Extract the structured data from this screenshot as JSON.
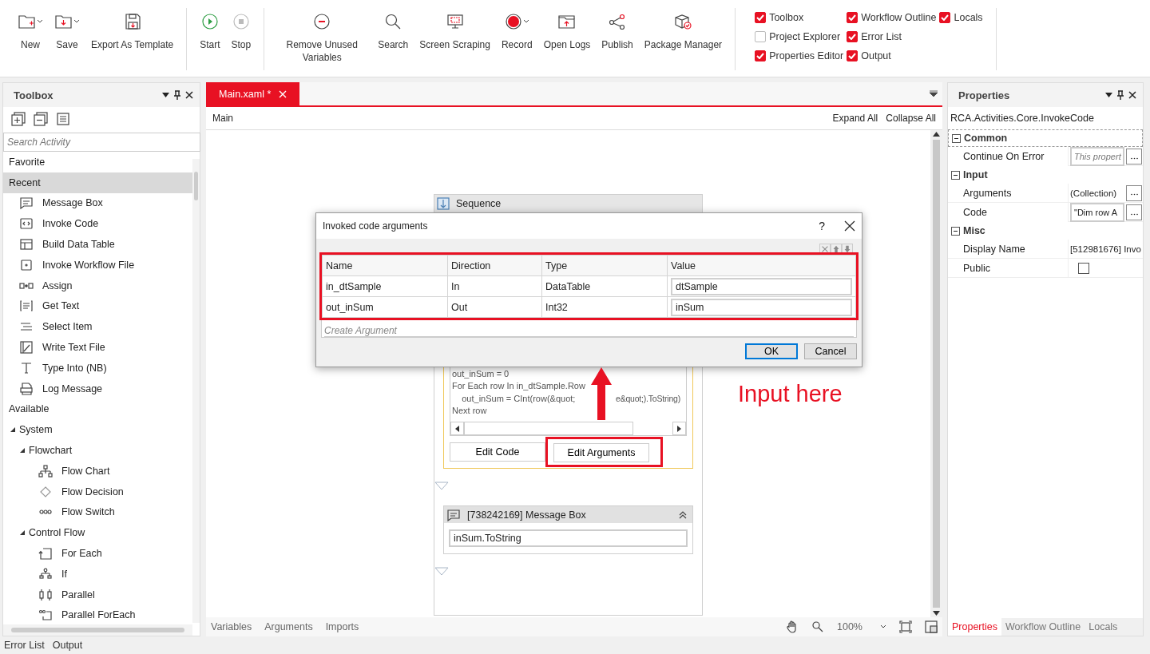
{
  "ribbon": {
    "groups": [
      {
        "buttons": [
          {
            "label": "New",
            "dropdown": true,
            "disabled": false
          },
          {
            "label": "Save",
            "dropdown": true,
            "disabled": false
          },
          {
            "label": "Export As Template",
            "dropdown": false,
            "disabled": false
          }
        ]
      },
      {
        "buttons": [
          {
            "label": "Start",
            "dropdown": false,
            "disabled": false
          },
          {
            "label": "Stop",
            "dropdown": false,
            "disabled": true
          }
        ]
      },
      {
        "buttons": [
          {
            "label": "Remove Unused Variables",
            "dropdown": false,
            "disabled": false
          },
          {
            "label": "Search",
            "dropdown": false,
            "disabled": false
          },
          {
            "label": "Screen Scraping",
            "dropdown": false,
            "disabled": false
          },
          {
            "label": "Record",
            "dropdown": true,
            "disabled": false
          },
          {
            "label": "Open Logs",
            "dropdown": false,
            "disabled": false
          },
          {
            "label": "Publish",
            "dropdown": false,
            "disabled": false
          },
          {
            "label": "Package Manager",
            "dropdown": false,
            "disabled": false
          }
        ]
      }
    ],
    "panes": [
      {
        "label": "Toolbox",
        "checked": true
      },
      {
        "label": "Project Explorer",
        "checked": false
      },
      {
        "label": "Properties Editor",
        "checked": true
      },
      {
        "label": "Workflow Outline",
        "checked": true
      },
      {
        "label": "Error List",
        "checked": true
      },
      {
        "label": "Output",
        "checked": true
      },
      {
        "label": "Locals",
        "checked": true
      }
    ]
  },
  "toolbox": {
    "title": "Toolbox",
    "search": {
      "placeholder": "Search Activity"
    },
    "tree": [
      {
        "label": "Favorite",
        "kind": "section",
        "selected": false
      },
      {
        "label": "Recent",
        "kind": "section",
        "selected": true,
        "children": [
          {
            "label": "Message Box",
            "kind": "item",
            "selected": false
          },
          {
            "label": "Invoke Code",
            "kind": "item",
            "selected": false
          },
          {
            "label": "Build Data Table",
            "kind": "item",
            "selected": false
          },
          {
            "label": "Invoke Workflow File",
            "kind": "item",
            "selected": false
          },
          {
            "label": "Assign",
            "kind": "item",
            "selected": false
          },
          {
            "label": "Get Text",
            "kind": "item",
            "selected": false
          },
          {
            "label": "Select Item",
            "kind": "item",
            "selected": false
          },
          {
            "label": "Write Text File",
            "kind": "item",
            "selected": false
          },
          {
            "label": "Type Into (NB)",
            "kind": "item",
            "selected": false
          },
          {
            "label": "Log Message",
            "kind": "item",
            "selected": false
          }
        ]
      },
      {
        "label": "Available",
        "kind": "section",
        "selected": false
      },
      {
        "label": "System",
        "kind": "group",
        "selected": false,
        "expanded": true,
        "children": [
          {
            "label": "Flowchart",
            "kind": "group",
            "selected": false,
            "expanded": true,
            "children": [
              {
                "label": "Flow Chart",
                "kind": "item",
                "selected": false
              },
              {
                "label": "Flow Decision",
                "kind": "item",
                "selected": false
              },
              {
                "label": "Flow Switch",
                "kind": "item",
                "selected": false
              }
            ]
          },
          {
            "label": "Control Flow",
            "kind": "group",
            "selected": false,
            "expanded": true,
            "children": [
              {
                "label": "For Each",
                "kind": "item",
                "selected": false
              },
              {
                "label": "If",
                "kind": "item",
                "selected": false
              },
              {
                "label": "Parallel",
                "kind": "item",
                "selected": false
              },
              {
                "label": "Parallel ForEach",
                "kind": "item",
                "selected": false
              }
            ]
          }
        ]
      }
    ]
  },
  "editor": {
    "tabs": [
      {
        "label": "Main.xaml *",
        "selected": true
      }
    ],
    "breadcrumb": "Main",
    "actions": [
      "Expand All",
      "Collapse All"
    ],
    "sequence": {
      "title": "Sequence",
      "invoke_code": {
        "code_lines": [
          [
            "out_inSum = 0"
          ],
          [
            "For Each row In in_dtSample.Row"
          ],
          [
            "    out_inSum = CInt(row(&quot;",
            "e&quot;).ToString)"
          ],
          [
            "Next row"
          ]
        ],
        "buttons": [
          "Edit Code",
          "Edit Arguments"
        ]
      },
      "message_box": {
        "title": "[738242169] Message Box",
        "value": "inSum.ToString"
      }
    },
    "dialog": {
      "title": "Invoked code arguments",
      "help": "?",
      "columns": [
        "Name",
        "Direction",
        "Type",
        "Value"
      ],
      "rows": [
        [
          "in_dtSample",
          "In",
          "DataTable",
          "dtSample"
        ],
        [
          "out_inSum",
          "Out",
          "Int32",
          "inSum"
        ]
      ],
      "new_row_placeholder": "Create Argument",
      "buttons": [
        {
          "label": "OK",
          "default": true
        },
        {
          "label": "Cancel",
          "default": false
        }
      ]
    },
    "annotation": {
      "text": "Input here"
    },
    "bottom_tabs": [
      "Variables",
      "Arguments",
      "Imports"
    ],
    "zoom": "100%"
  },
  "properties": {
    "title": "Properties",
    "type_name": "RCA.Activities.Core.InvokeCode",
    "sections": [
      {
        "title": "Common",
        "expanded": true,
        "rows": [
          {
            "name": "Continue On Error",
            "kind": "field",
            "placeholder": "This propert",
            "button": true
          }
        ]
      },
      {
        "title": "Input",
        "expanded": true,
        "rows": [
          {
            "name": "Arguments",
            "kind": "text",
            "value": "(Collection)",
            "button": true
          },
          {
            "name": "Code",
            "kind": "field",
            "value": "\"Dim row A",
            "button": true
          }
        ]
      },
      {
        "title": "Misc",
        "expanded": true,
        "rows": [
          {
            "name": "Display Name",
            "kind": "text",
            "value": "[512981676] Invo",
            "button": false
          },
          {
            "name": "Public",
            "kind": "checkbox",
            "checked": false,
            "button": false
          }
        ]
      }
    ],
    "tabs": [
      {
        "label": "Properties",
        "selected": true
      },
      {
        "label": "Workflow Outline",
        "selected": false
      },
      {
        "label": "Locals",
        "selected": false
      }
    ]
  },
  "status_bar": {
    "tabs": [
      "Error List",
      "Output"
    ]
  }
}
